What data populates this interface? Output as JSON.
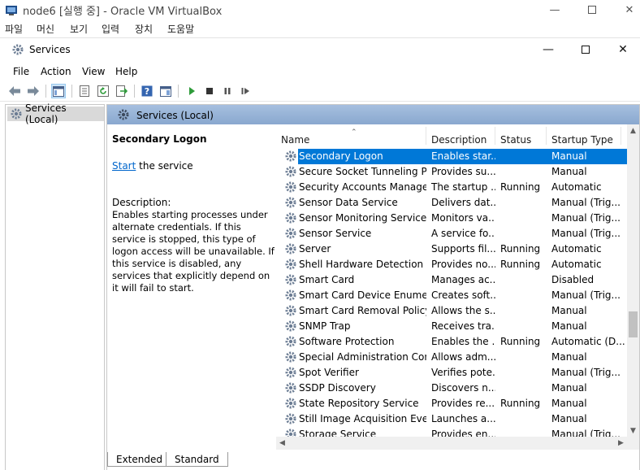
{
  "vbox": {
    "title": "node6 [실행 중] - Oracle VM VirtualBox",
    "menu": [
      "파일",
      "머신",
      "보기",
      "입력",
      "장치",
      "도움말"
    ]
  },
  "window": {
    "title": "Services",
    "menu": [
      "File",
      "Action",
      "View",
      "Help"
    ]
  },
  "tree": {
    "root": "Services (Local)"
  },
  "header": {
    "title": "Services (Local)"
  },
  "description": {
    "service_name": "Secondary Logon",
    "action_link": "Start",
    "action_suffix": " the service",
    "label": "Description:",
    "text": "Enables starting processes under alternate credentials. If this service is stopped, this type of logon access will be unavailable. If this service is disabled, any services that explicitly depend on it will fail to start."
  },
  "columns": {
    "name": "Name",
    "description": "Description",
    "status": "Status",
    "startup": "Startup Type"
  },
  "services": [
    {
      "name": "Secondary Logon",
      "description": "Enables star...",
      "status": "",
      "startup": "Manual"
    },
    {
      "name": "Secure Socket Tunneling Pr...",
      "description": "Provides su...",
      "status": "",
      "startup": "Manual"
    },
    {
      "name": "Security Accounts Manager",
      "description": "The startup ...",
      "status": "Running",
      "startup": "Automatic"
    },
    {
      "name": "Sensor Data Service",
      "description": "Delivers dat...",
      "status": "",
      "startup": "Manual (Trig..."
    },
    {
      "name": "Sensor Monitoring Service",
      "description": "Monitors va...",
      "status": "",
      "startup": "Manual (Trig..."
    },
    {
      "name": "Sensor Service",
      "description": "A service fo...",
      "status": "",
      "startup": "Manual (Trig..."
    },
    {
      "name": "Server",
      "description": "Supports fil...",
      "status": "Running",
      "startup": "Automatic"
    },
    {
      "name": "Shell Hardware Detection",
      "description": "Provides no...",
      "status": "Running",
      "startup": "Automatic"
    },
    {
      "name": "Smart Card",
      "description": "Manages ac...",
      "status": "",
      "startup": "Disabled"
    },
    {
      "name": "Smart Card Device Enumera...",
      "description": "Creates soft...",
      "status": "",
      "startup": "Manual (Trig..."
    },
    {
      "name": "Smart Card Removal Policy",
      "description": "Allows the s...",
      "status": "",
      "startup": "Manual"
    },
    {
      "name": "SNMP Trap",
      "description": "Receives tra...",
      "status": "",
      "startup": "Manual"
    },
    {
      "name": "Software Protection",
      "description": "Enables the ...",
      "status": "Running",
      "startup": "Automatic (D..."
    },
    {
      "name": "Special Administration Con...",
      "description": "Allows adm...",
      "status": "",
      "startup": "Manual"
    },
    {
      "name": "Spot Verifier",
      "description": "Verifies pote...",
      "status": "",
      "startup": "Manual (Trig..."
    },
    {
      "name": "SSDP Discovery",
      "description": "Discovers n...",
      "status": "",
      "startup": "Manual"
    },
    {
      "name": "State Repository Service",
      "description": "Provides re...",
      "status": "Running",
      "startup": "Manual"
    },
    {
      "name": "Still Image Acquisition Events",
      "description": "Launches a...",
      "status": "",
      "startup": "Manual"
    },
    {
      "name": "Storage Service",
      "description": "Provides en...",
      "status": "",
      "startup": "Manual (Trig..."
    }
  ],
  "tabs": [
    "Extended",
    "Standard"
  ],
  "colors": {
    "selection": "#0078d7",
    "header": "#95b3d7",
    "link": "#0066cc"
  }
}
